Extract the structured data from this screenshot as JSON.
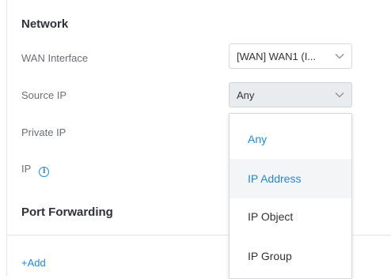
{
  "network": {
    "title": "Network",
    "wan_interface": {
      "label": "WAN Interface",
      "value": "[WAN] WAN1 (I..."
    },
    "source_ip": {
      "label": "Source IP",
      "value": "Any"
    },
    "private_ip": {
      "label": "Private IP"
    },
    "ip": {
      "label": "IP",
      "info_icon": "info-circle-icon"
    }
  },
  "port_forwarding": {
    "title": "Port Forwarding",
    "add_label": "+Add"
  },
  "source_ip_dropdown": {
    "options": [
      "Any",
      "IP Address",
      "IP Object",
      "IP Group"
    ],
    "selected": "Any",
    "hovered": "IP Address"
  },
  "colors": {
    "accent": "#1e88e5",
    "label": "#6b6f75",
    "title": "#2e3238",
    "border": "#d5d9de",
    "active_select_bg": "#e9ecef",
    "hover_bg": "#f3f5f7"
  }
}
